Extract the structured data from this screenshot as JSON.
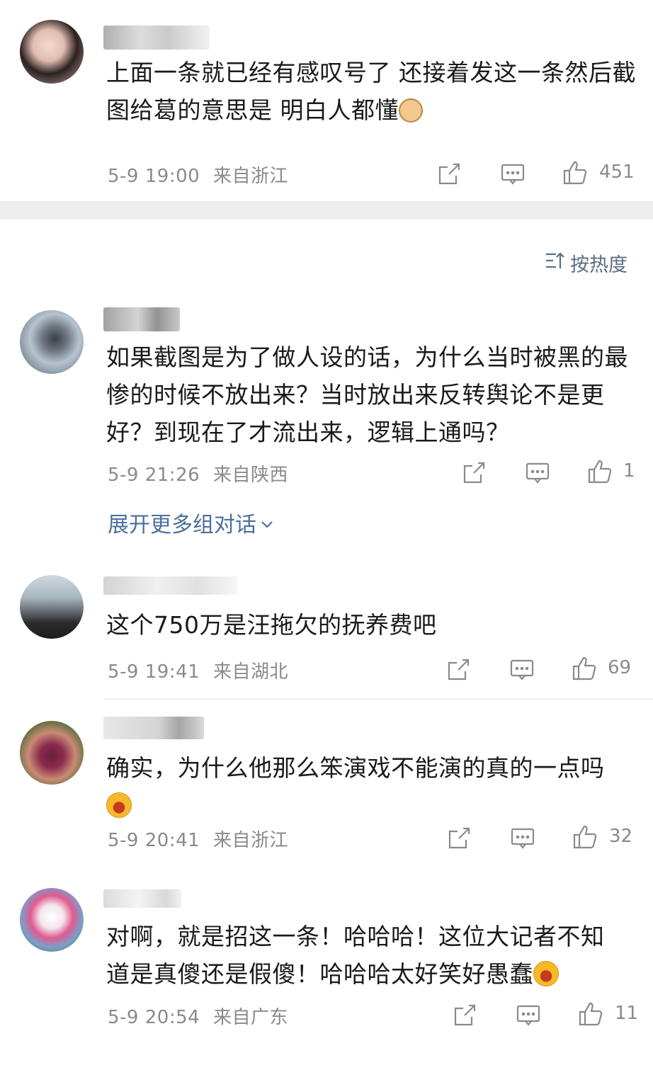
{
  "sort_label": "按热度",
  "expand_label": "展开更多组对话",
  "comments": [
    {
      "text": "上面一条就已经有感叹号了 还接着发这一条然后截图给葛的意思是 明白人都懂",
      "date": "5-9 19:00",
      "location": "来自浙江",
      "likes": "451",
      "emoji": "cat-face-icon"
    },
    {
      "text": "如果截图是为了做人设的话，为什么当时被黑的最惨的时候不放出来？当时放出来反转舆论不是更好？到现在了才流出来，逻辑上通吗？",
      "date": "5-9 21:26",
      "location": "来自陕西",
      "likes": "1"
    },
    {
      "text": "这个750万是汪拖欠的抚养费吧",
      "date": "5-9 19:41",
      "location": "来自湖北",
      "likes": "69"
    },
    {
      "text": "确实，为什么他那么笨演戏不能演的真的一点吗",
      "date": "5-9 20:41",
      "location": "来自浙江",
      "likes": "32",
      "emoji": "laughing-face-icon"
    },
    {
      "text": "对啊，就是招这一条！哈哈哈！这位大记者不知道是真傻还是假傻！哈哈哈太好笑好愚蠢",
      "date": "5-9 20:54",
      "location": "来自广东",
      "likes": "11",
      "emoji": "laughing-face-icon"
    }
  ],
  "colors": {
    "text": "#1a1a1a",
    "meta": "#8a8a8a",
    "link": "#4a6f9e",
    "band": "#eeeeee"
  }
}
